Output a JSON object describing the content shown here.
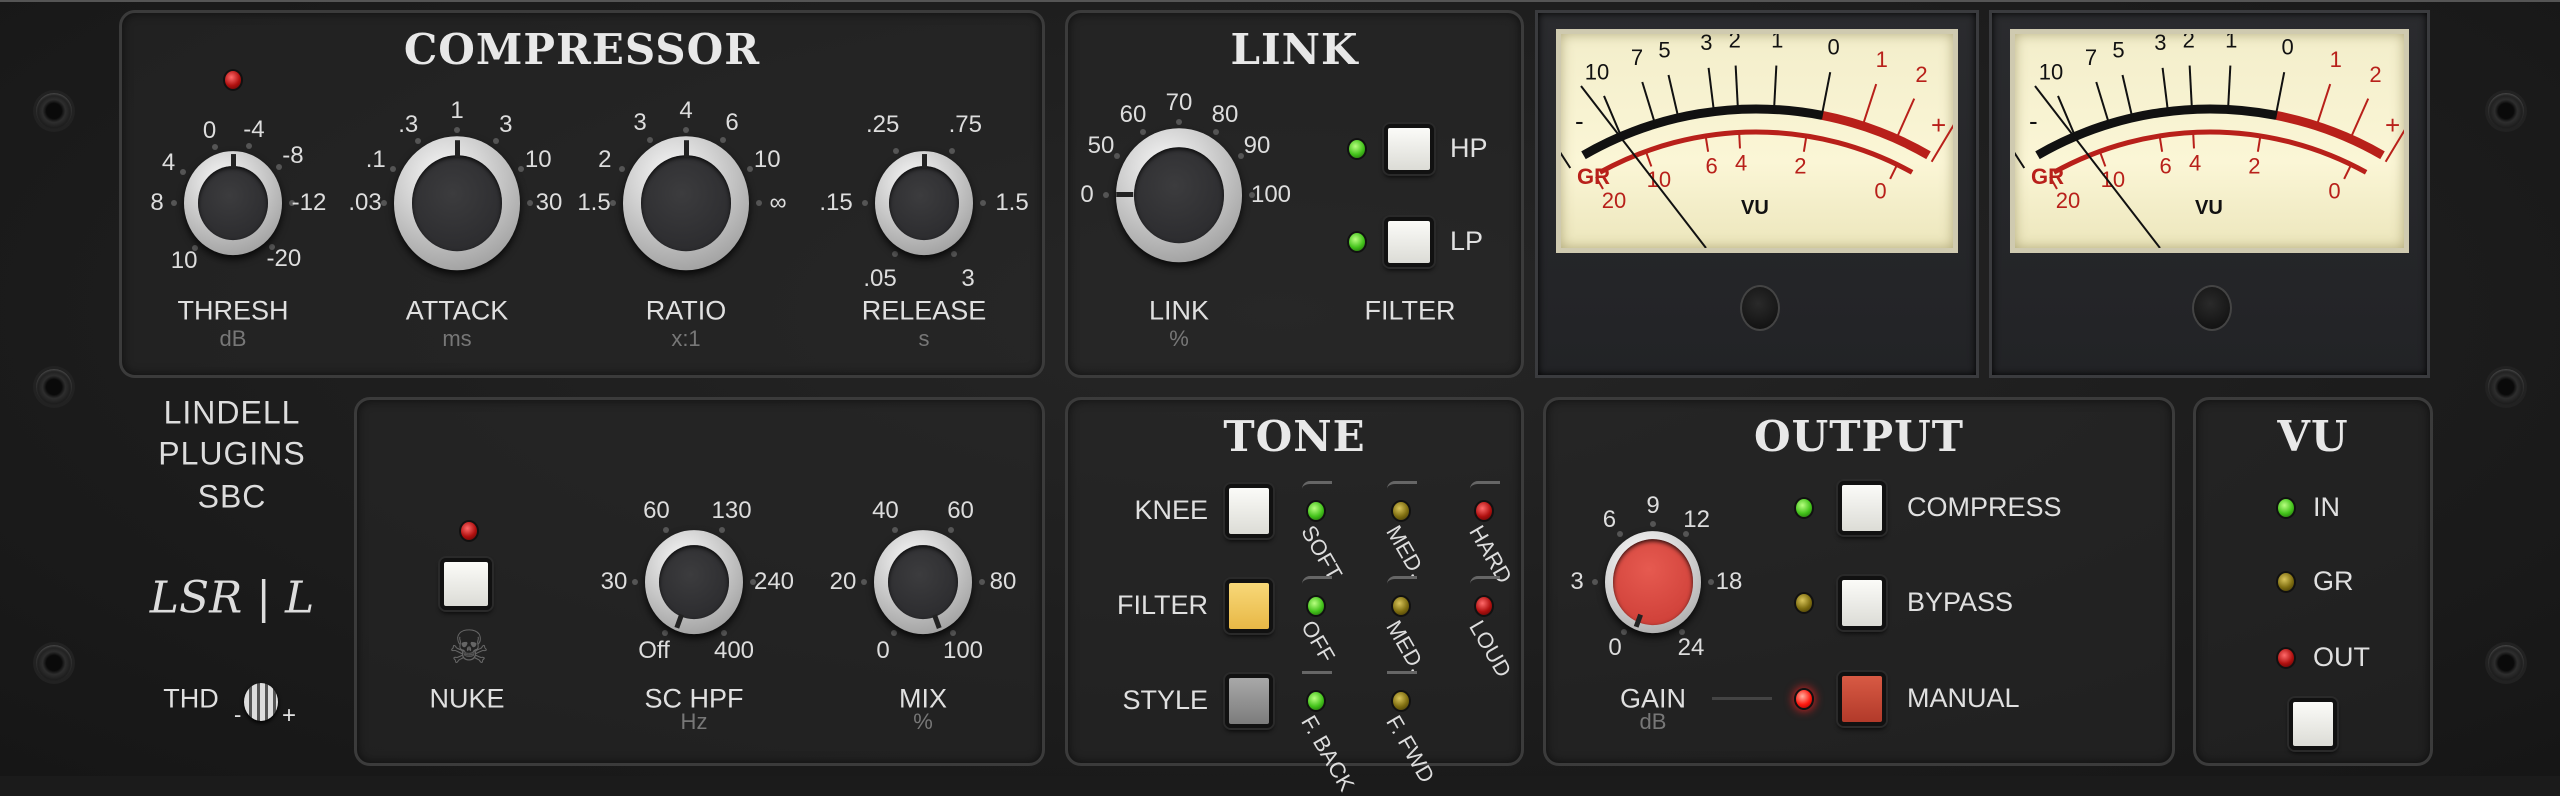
{
  "compressor": {
    "title": "COMPRESSOR",
    "thresh": {
      "label": "THRESH",
      "unit": "dB",
      "scale": [
        "10",
        "8",
        "4",
        "0",
        "-4",
        "-8",
        "-12",
        "-20"
      ]
    },
    "attack": {
      "label": "ATTACK",
      "unit": "ms",
      "scale": [
        ".03",
        ".1",
        ".3",
        "1",
        "3",
        "10",
        "30"
      ]
    },
    "ratio": {
      "label": "RATIO",
      "unit": "x:1",
      "scale": [
        "1.5",
        "2",
        "3",
        "4",
        "6",
        "10",
        "∞"
      ]
    },
    "release": {
      "label": "RELEASE",
      "unit": "s",
      "scale": [
        ".05",
        ".15",
        ".25",
        ".75",
        "1.5",
        "3"
      ]
    }
  },
  "link": {
    "title": "LINK",
    "link": {
      "label": "LINK",
      "unit": "%",
      "scale": [
        "0",
        "50",
        "60",
        "70",
        "80",
        "90",
        "100"
      ]
    },
    "filter_label": "FILTER",
    "hp": "HP",
    "lp": "LP"
  },
  "meters": {
    "top_scale": [
      "20",
      "10",
      "7",
      "5",
      "3",
      "2",
      "1",
      "0",
      "1",
      "2",
      "3"
    ],
    "gr_scale": [
      "20",
      "10",
      "6",
      "4",
      "2",
      "0"
    ],
    "gr": "GR",
    "vu": "VU",
    "minus": "-",
    "plus": "+"
  },
  "brand": {
    "line1": "LINDELL",
    "line2": "PLUGINS",
    "line3": "SBC",
    "logo": "LSR | L",
    "thd": "THD",
    "thd_minus": "-",
    "thd_plus": "+"
  },
  "sidechain": {
    "nuke": "NUKE",
    "schpf": {
      "label": "SC HPF",
      "unit": "Hz",
      "scale": [
        "Off",
        "30",
        "60",
        "130",
        "240",
        "400"
      ]
    },
    "mix": {
      "label": "MIX",
      "unit": "%",
      "scale": [
        "0",
        "20",
        "40",
        "60",
        "80",
        "100"
      ]
    }
  },
  "tone": {
    "title": "TONE",
    "rows": [
      {
        "label": "KNEE",
        "leds": [
          "SOFT",
          "MED.",
          "HARD"
        ]
      },
      {
        "label": "FILTER",
        "leds": [
          "OFF",
          "MED.",
          "LOUD"
        ]
      },
      {
        "label": "STYLE",
        "leds": [
          "F. BACK",
          "F. FWD"
        ]
      }
    ]
  },
  "output": {
    "title": "OUTPUT",
    "gain": {
      "label": "GAIN",
      "unit": "dB",
      "scale": [
        "0",
        "3",
        "6",
        "9",
        "12",
        "18",
        "24"
      ]
    },
    "modes": [
      "COMPRESS",
      "BYPASS",
      "MANUAL"
    ]
  },
  "vu": {
    "title": "VU",
    "sources": [
      "IN",
      "GR",
      "OUT"
    ]
  },
  "colors": {
    "led_green": "#42c21a",
    "led_yellow": "#7e6d10",
    "led_red": "#b0100f",
    "gain_knob": "#d8463e",
    "meter_red": "#b8201a",
    "filter_button": "#f2c75a"
  }
}
